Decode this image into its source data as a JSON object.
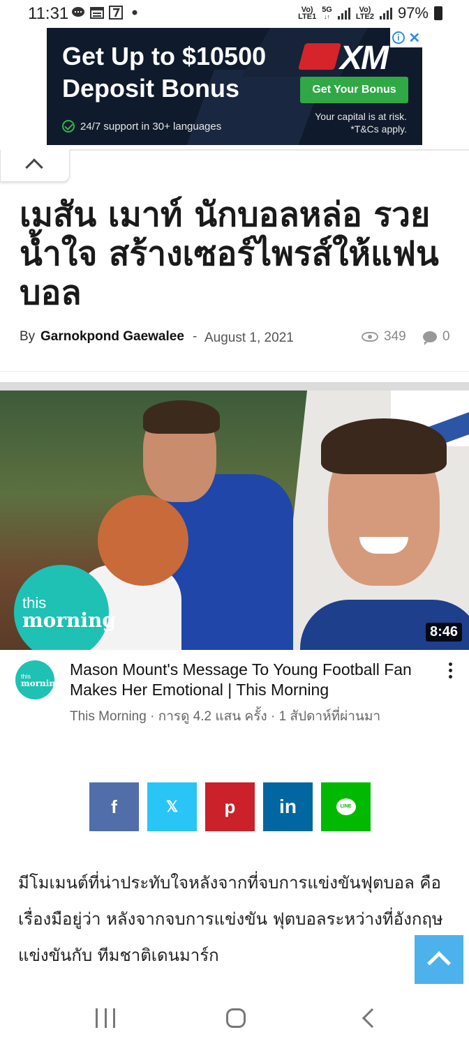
{
  "status_bar": {
    "time": "11:31",
    "net_label_1": "Vo)",
    "net_label_1b": "LTE1",
    "net_label_2": "5G",
    "net_label_3": "Vo)",
    "net_label_3b": "LTE2",
    "battery": "97%"
  },
  "ad": {
    "headline": "Get Up to $10500 Deposit Bonus",
    "brand": "XM",
    "cta": "Get Your Bonus",
    "support": "24/7 support in 30+ languages",
    "risk_line1": "Your capital is at risk.",
    "risk_line2": "*T&Cs apply.",
    "info_icon": "i",
    "close_icon": "✕"
  },
  "article": {
    "title": "เมสัน เมาท์ นักบอลหล่อ รวยน้ำใจ สร้างเซอร์ไพรส์ให้แฟนบอล",
    "by": "By",
    "author": "Garnokpond Gaewalee",
    "dash": "-",
    "date": "August 1, 2021",
    "views": "349",
    "comments": "0",
    "body": "มีโมเมนต์ที่น่าประทับใจหลังจากที่จบการแข่งขันฟุตบอล คือ เรื่องมือยู่ว่า หลังจากจบการแข่งขัน ฟุตบอลระหว่างที่อังกฤษ แข่งขันกับ ทีมชาติเดนมาร์ก"
  },
  "video": {
    "logo_line1": "this",
    "logo_line2": "morning",
    "duration": "8:46",
    "title": "Mason Mount's Message To Young Football Fan Makes Her Emotional | This Morning",
    "subtitle": "This Morning · การดู 4.2 แสน ครั้ง · 1 สัปดาห์ที่ผ่านมา",
    "avatar_line1": "this",
    "avatar_line2": "morning"
  },
  "share": {
    "facebook": "f",
    "x": "𝕏",
    "pinterest": "p",
    "linkedin": "in",
    "line": "LINE"
  },
  "colors": {
    "facebook": "#516eab",
    "x": "#29c5f6",
    "pinterest": "#ca212a",
    "linkedin": "#0266a0",
    "line": "#00b900",
    "scroll_top": "#4db2ec",
    "this_morning": "#1fc1b4"
  },
  "icons": {
    "collapse": "chevron-up-icon",
    "views": "eye-icon",
    "comments": "comment-icon",
    "scroll_top": "arrow-up-icon",
    "more": "more-vert-icon"
  }
}
